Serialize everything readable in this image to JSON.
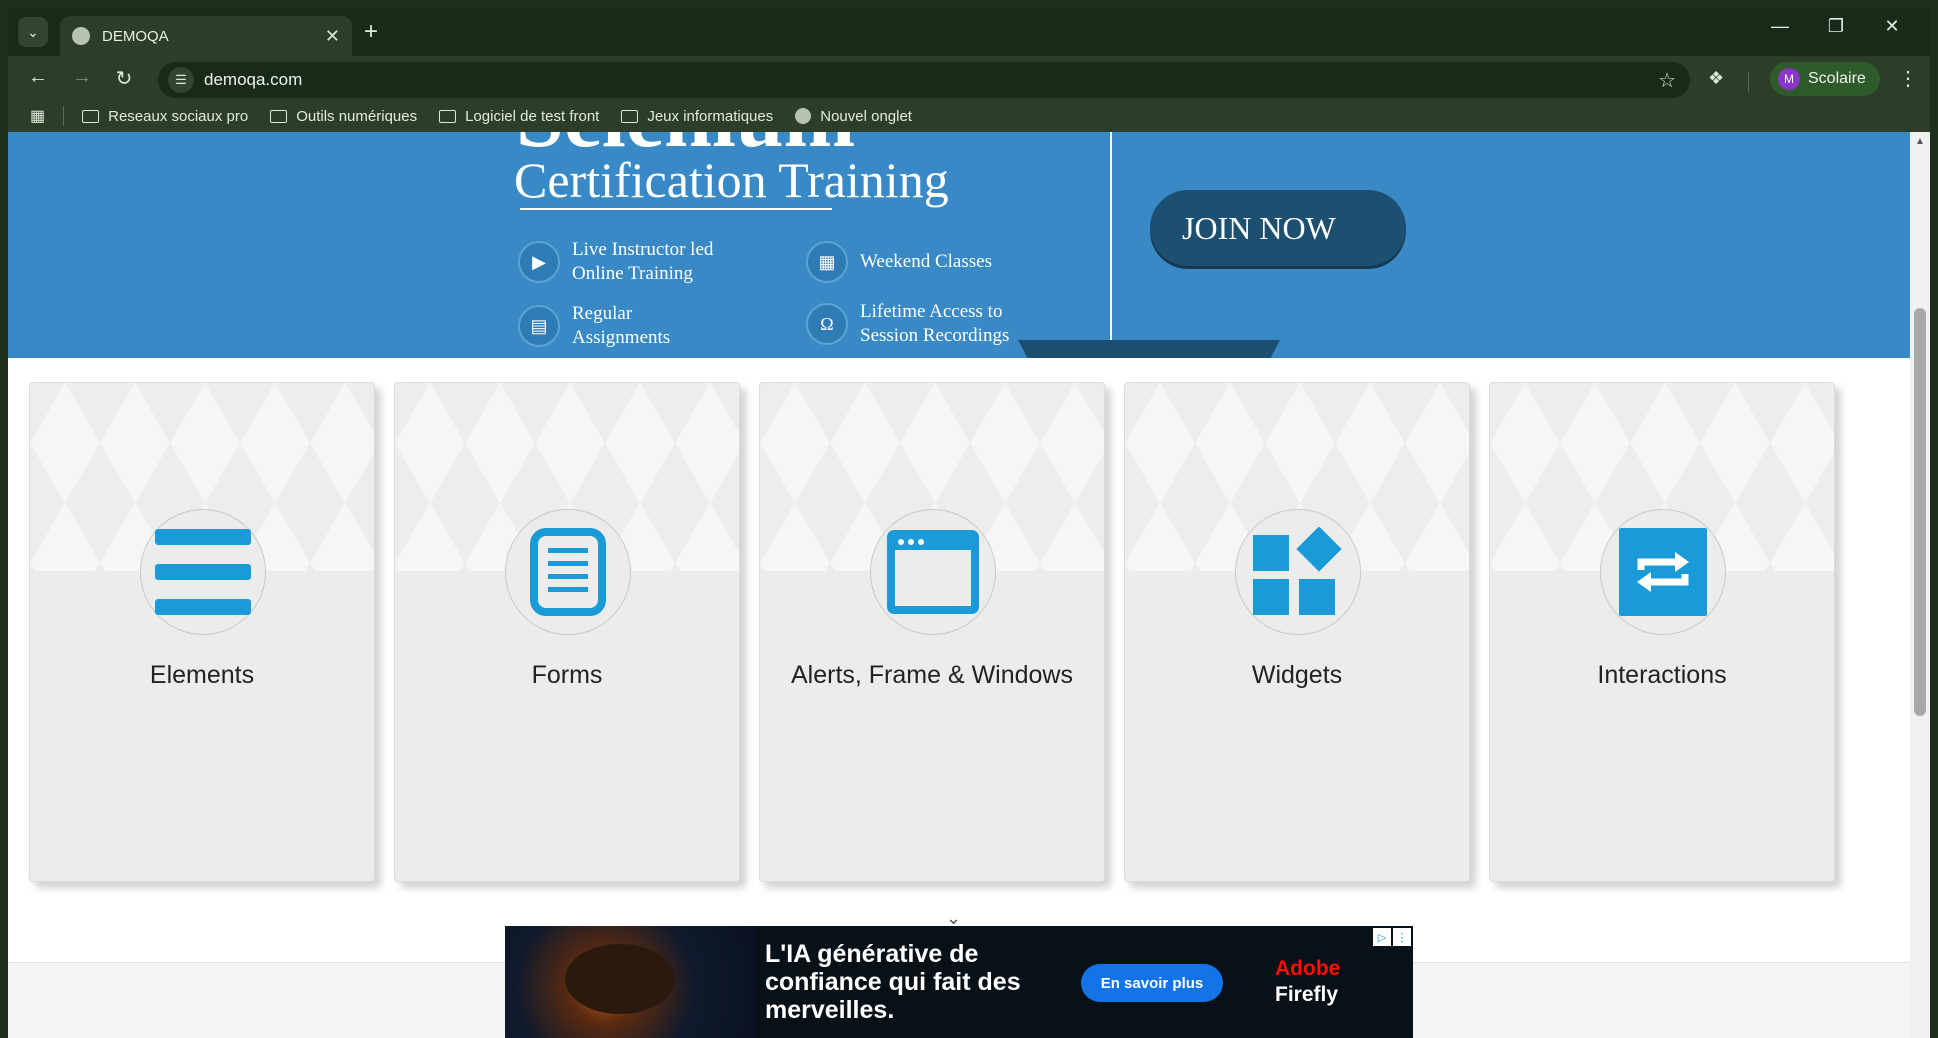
{
  "browser": {
    "tab_title": "DEMOQA",
    "url": "demoqa.com",
    "profile_initial": "M",
    "profile_name": "Scolaire",
    "bookmarks": [
      "Reseaux sociaux pro",
      "Outils numériques",
      "Logiciel de test front",
      "Jeux informatiques",
      "Nouvel onglet"
    ]
  },
  "banner": {
    "heading_partial": "Selenium",
    "subheading": "Certification Training",
    "features": [
      {
        "line1": "Live Instructor led",
        "line2": "Online Training",
        "icon": "play-icon"
      },
      {
        "line1": "Weekend Classes",
        "line2": "",
        "icon": "calendar-icon"
      },
      {
        "line1": "Regular",
        "line2": "Assignments",
        "icon": "document-icon"
      },
      {
        "line1": "Lifetime Access to",
        "line2": "Session Recordings",
        "icon": "headphones-icon"
      }
    ],
    "cta": "JOIN NOW"
  },
  "cards": [
    {
      "label": "Elements",
      "icon": "hamburger-icon"
    },
    {
      "label": "Forms",
      "icon": "form-icon"
    },
    {
      "label": "Alerts, Frame & Windows",
      "icon": "window-icon"
    },
    {
      "label": "Widgets",
      "icon": "widgets-icon"
    },
    {
      "label": "Interactions",
      "icon": "swap-arrows-icon"
    }
  ],
  "ad": {
    "headline": "L'IA générative de confiance qui fait des merveilles.",
    "cta": "En savoir plus",
    "brand_line1": "Adobe",
    "brand_line2": "Firefly"
  },
  "colors": {
    "banner_blue": "#3889c5",
    "cta_navy": "#1c4f70",
    "icon_blue": "#1a9bd7",
    "adobe_red": "#fa0f00"
  }
}
